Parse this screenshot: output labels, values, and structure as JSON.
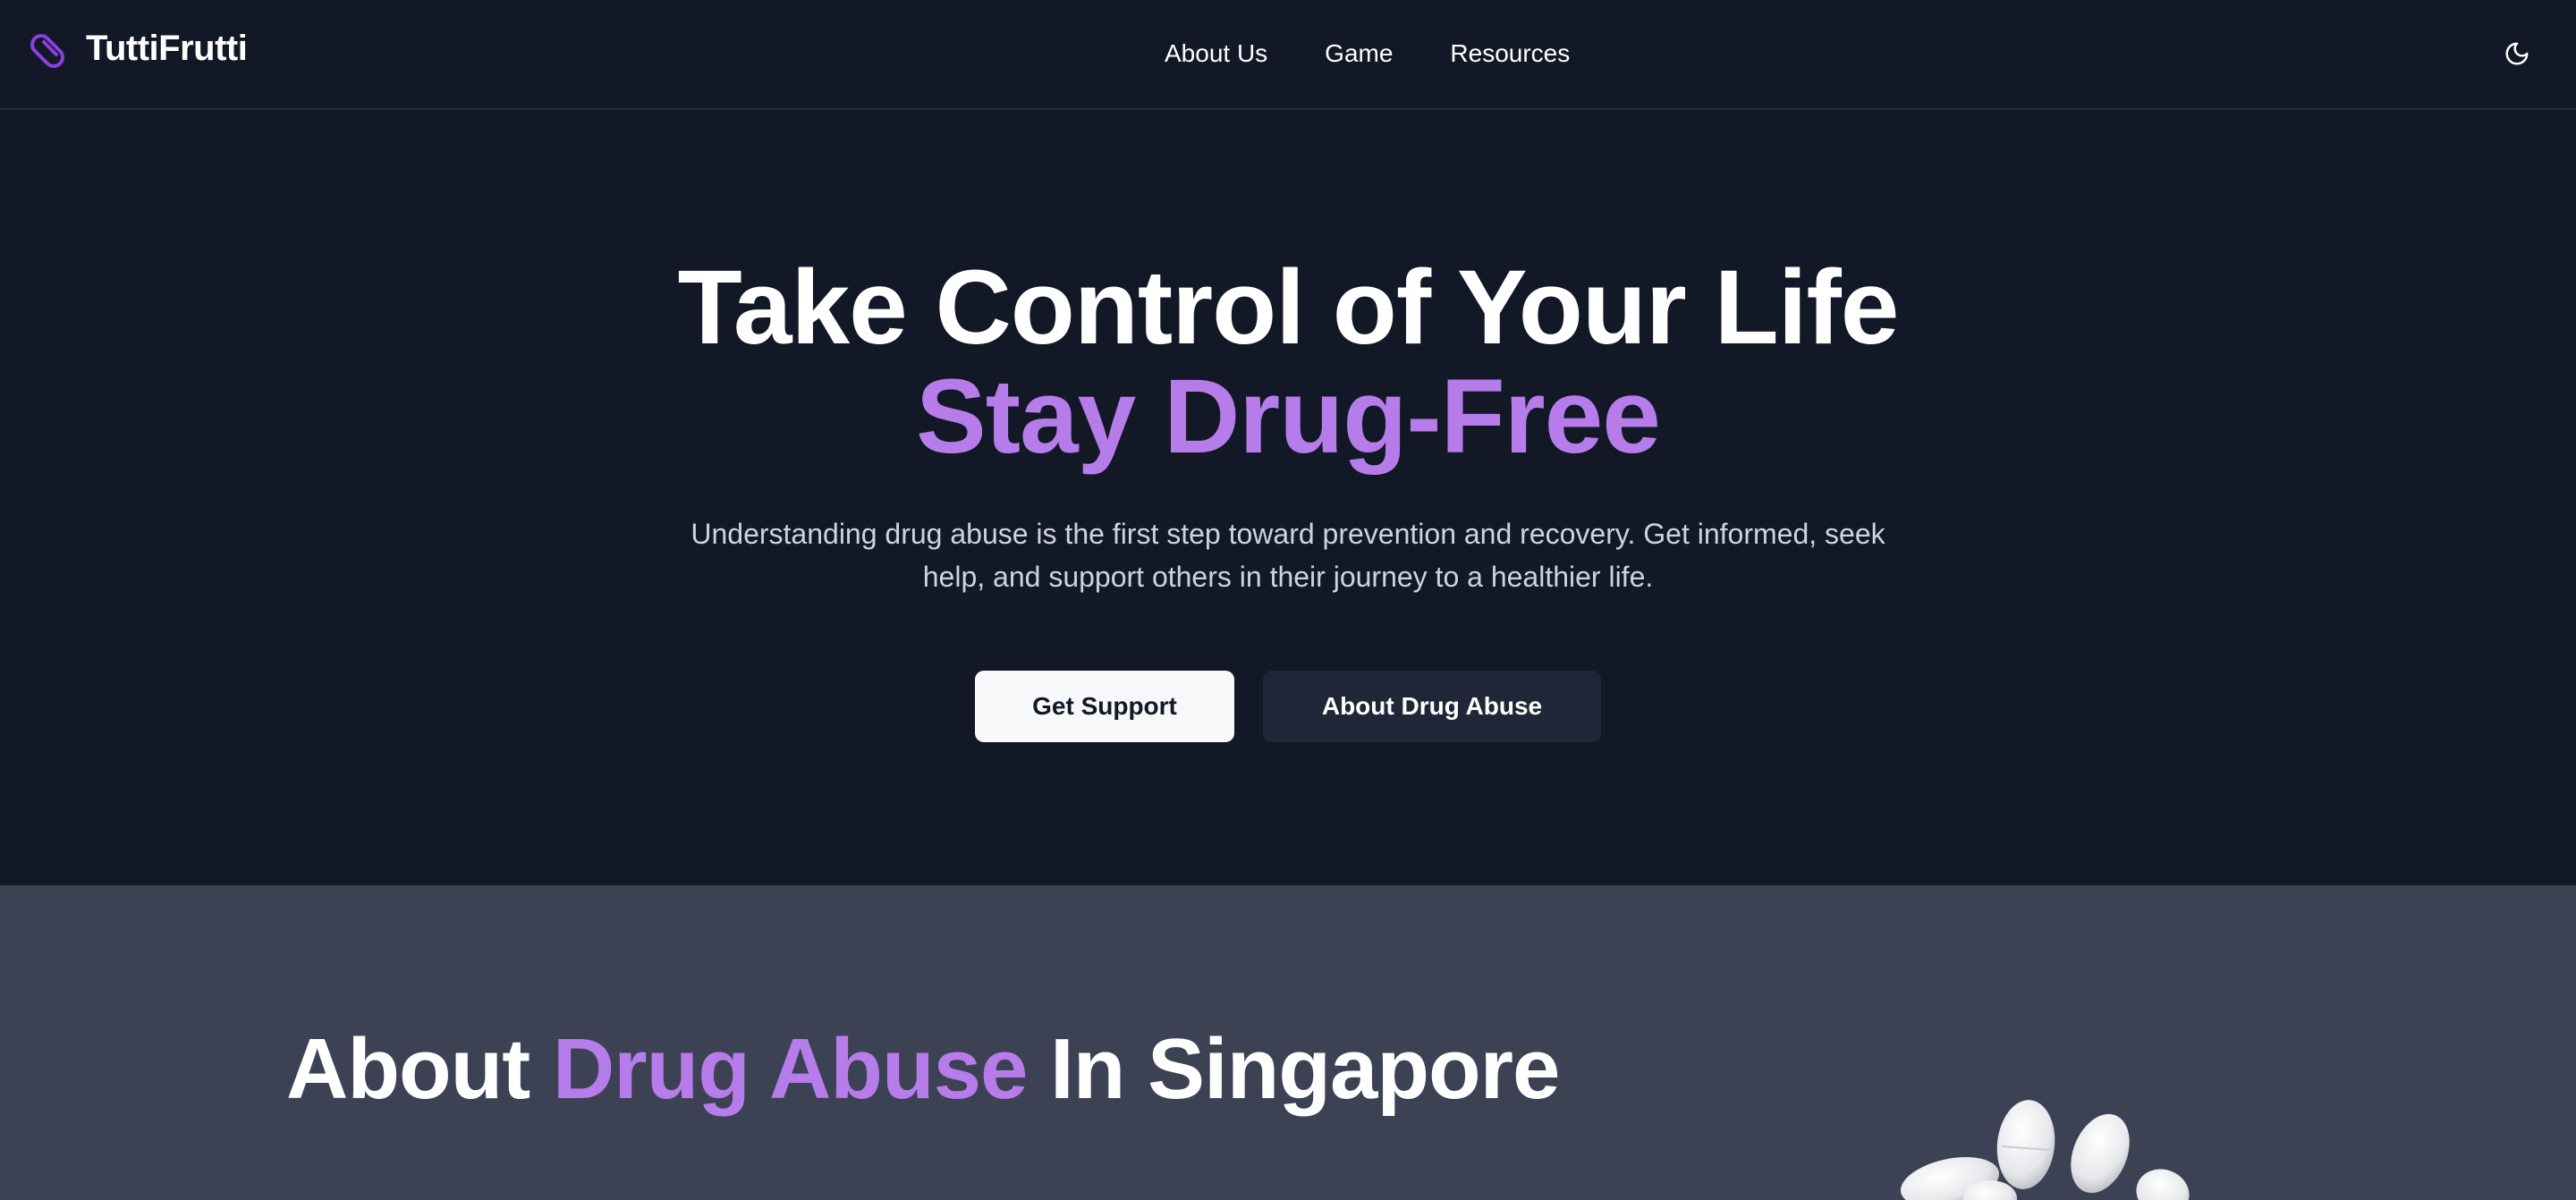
{
  "brand": {
    "name": "TuttiFrutti",
    "icon": "pill-icon",
    "accent_color": "#b57cea"
  },
  "nav": {
    "items": [
      {
        "label": "About Us"
      },
      {
        "label": "Game"
      },
      {
        "label": "Resources"
      }
    ],
    "theme_toggle_icon": "moon-icon"
  },
  "hero": {
    "title_line1": "Take Control of Your Life",
    "title_line2": "Stay Drug-Free",
    "subtitle": "Understanding drug abuse is the first step toward prevention and recovery. Get informed, seek help, and support others in their journey to a healthier life.",
    "primary_button": "Get Support",
    "secondary_button": "About Drug Abuse"
  },
  "about": {
    "title_prefix": "About ",
    "title_accent": "Drug Abuse",
    "title_suffix": " In Singapore",
    "image_icon": "pills-illustration"
  },
  "colors": {
    "background": "#131826",
    "section_background": "#3c4253",
    "accent": "#b57cea"
  }
}
